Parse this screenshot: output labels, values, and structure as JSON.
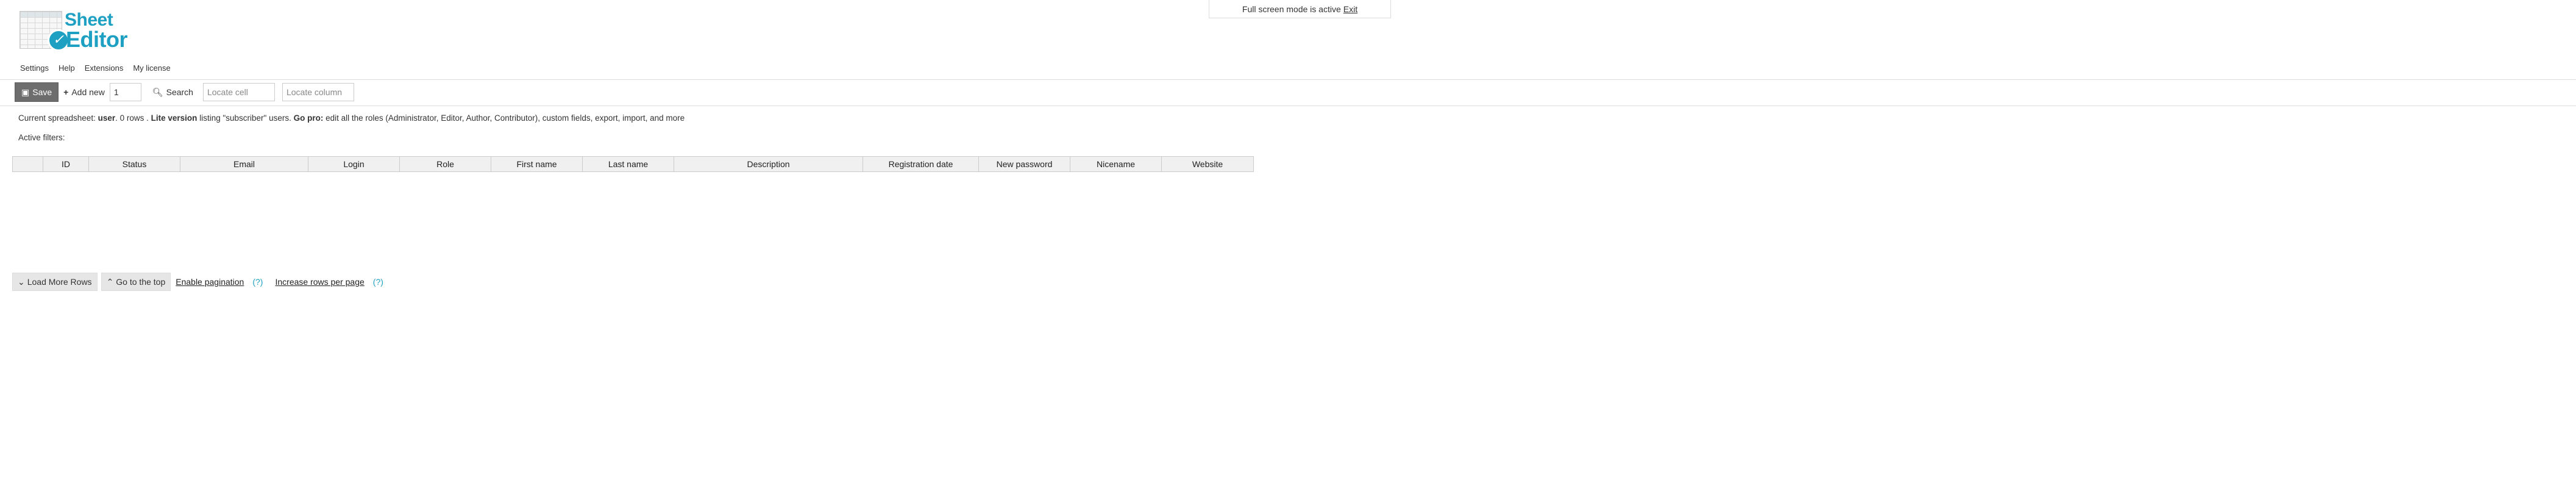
{
  "fullscreen": {
    "text": "Full screen mode is active",
    "exit_label": "Exit"
  },
  "logo": {
    "line1": "Sheet",
    "line2": "Editor"
  },
  "menu": [
    "Settings",
    "Help",
    "Extensions",
    "My license"
  ],
  "toolbar": {
    "save_label": "Save",
    "add_new_label": "Add new",
    "add_new_count": "1",
    "search_label": "Search",
    "locate_cell_placeholder": "Locate cell",
    "locate_column_placeholder": "Locate column"
  },
  "status": {
    "prefix": "Current spreadsheet:",
    "sheet": "user",
    "rows": ". 0 rows .",
    "lite": "Lite version",
    "lite_desc": "listing \"subscriber\" users.",
    "gopro": "Go pro:",
    "gopro_desc": "edit all the roles (Administrator, Editor, Author, Contributor), custom fields, export, import, and more"
  },
  "filters_label": "Active filters:",
  "columns": [
    "",
    "ID",
    "Status",
    "Email",
    "Login",
    "Role",
    "First name",
    "Last name",
    "Description",
    "Registration date",
    "New password",
    "Nicename",
    "Website"
  ],
  "bottom": {
    "load_more": "Load More Rows",
    "go_top": "Go to the top",
    "enable_pagination": "Enable pagination",
    "increase_rows": "Increase rows per page",
    "help_mark": "(?)"
  }
}
